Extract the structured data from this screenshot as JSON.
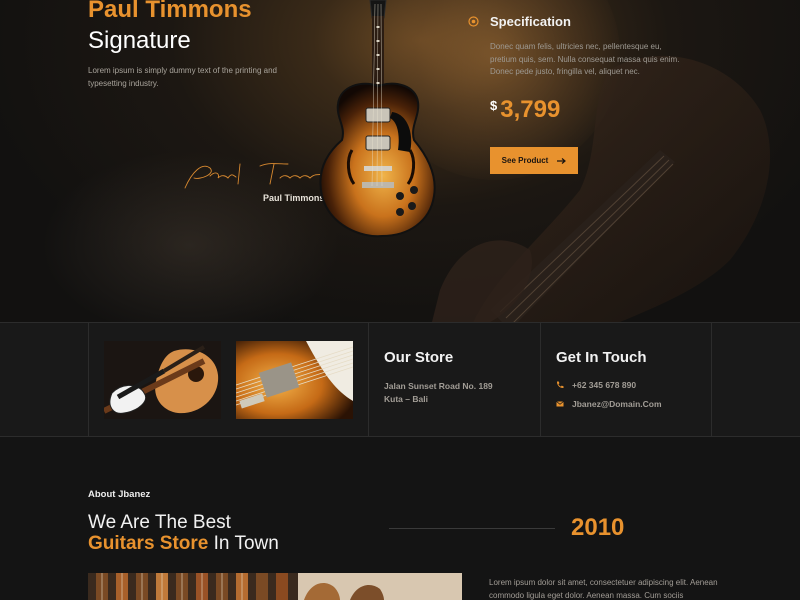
{
  "hero": {
    "title_line1": "Paul Timmons",
    "title_line2": "Signature",
    "description": "Lorem ipsum is simply dummy text of the printing and typesetting industry.",
    "signature_caption": "Paul Timmons",
    "spec_title": "Specification",
    "spec_description": "Donec quam felis, ultricies nec, pellentesque eu, pretium quis, sem. Nulla consequat massa quis enim. Donec pede justo, fringilla vel, aliquet nec.",
    "currency": "$",
    "price": "3,799",
    "cta_label": "See Product",
    "cta_icon": "arrow-right-icon"
  },
  "strip": {
    "store_title": "Our Store",
    "store_address_line1": "Jalan Sunset Road No. 189",
    "store_address_line2": "Kuta – Bali",
    "contact_title": "Get In Touch",
    "phone": "+62 345 678 890",
    "phone_icon": "phone-icon",
    "email": "Jbanez@Domain.Com",
    "email_icon": "mail-icon"
  },
  "about": {
    "label": "About Jbanez",
    "heading_line1": "We Are The Best",
    "heading_accent": "Guitars Store",
    "heading_rest": "In Town",
    "year": "2010",
    "text": "Lorem ipsum dolor sit amet, consectetuer adipiscing elit. Aenean commodo ligula eget dolor. Aenean massa. Cum sociis"
  },
  "colors": {
    "accent": "#e8922e",
    "background": "#141414",
    "strip_background": "#191919"
  }
}
